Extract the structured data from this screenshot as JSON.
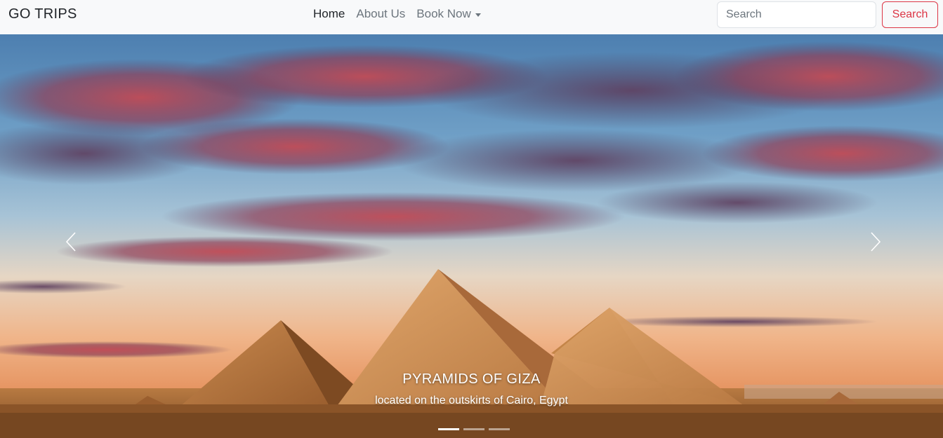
{
  "navbar": {
    "brand": "GO TRIPS",
    "links": [
      {
        "label": "Home",
        "active": true
      },
      {
        "label": "About Us",
        "active": false
      },
      {
        "label": "Book Now",
        "active": false,
        "dropdown": true
      }
    ],
    "search": {
      "placeholder": "Search",
      "value": "",
      "button_label": "Search"
    },
    "colors": {
      "background": "#f8f9fa",
      "search_button": "#dc3545"
    }
  },
  "carousel": {
    "slide": {
      "title": "PYRAMIDS OF GIZA",
      "subtitle": "located on the outskirts of Cairo, Egypt"
    },
    "indicators": [
      {
        "active": true
      },
      {
        "active": false
      },
      {
        "active": false
      }
    ],
    "controls": {
      "prev_icon": "chevron-left-icon",
      "next_icon": "chevron-right-icon"
    }
  }
}
